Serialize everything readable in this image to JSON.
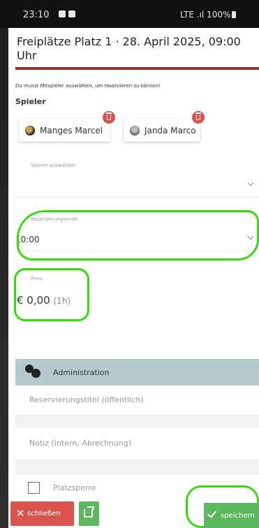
{
  "status_bar": {
    "time": "23:10",
    "right": "LTE .ıl 100%"
  },
  "dialog": {
    "title": "Freiplätze Platz 1 · 28. April 2025, 09:00 Uhr",
    "hint": "Du musst Mitspieler auswählen, um reservieren zu können!",
    "players_label": "Spieler",
    "players": [
      {
        "name": "Manges Marcel"
      },
      {
        "name": "Janda Marco"
      }
    ],
    "select_player_label": "Spieler auswählen",
    "reservation_end": {
      "label": "Reservierungsende",
      "value": "10:00"
    },
    "price": {
      "label": "Preis",
      "value": "€ 0,00",
      "duration": "(1h)"
    },
    "admin": {
      "title": "Administration",
      "title_placeholder": "Reservierungstitel (öffentlich)",
      "note_placeholder": "Notiz (intern, Abrechnung)",
      "lock_label": "Platzsperre"
    }
  },
  "footer": {
    "close_label": "schließen",
    "save_label": "speichern"
  },
  "colors": {
    "accent_rule": "#9b2a2a",
    "danger": "#d9534f",
    "success": "#5cb85c",
    "admin_header": "#b5c9cc",
    "annotation": "#39d80c"
  }
}
